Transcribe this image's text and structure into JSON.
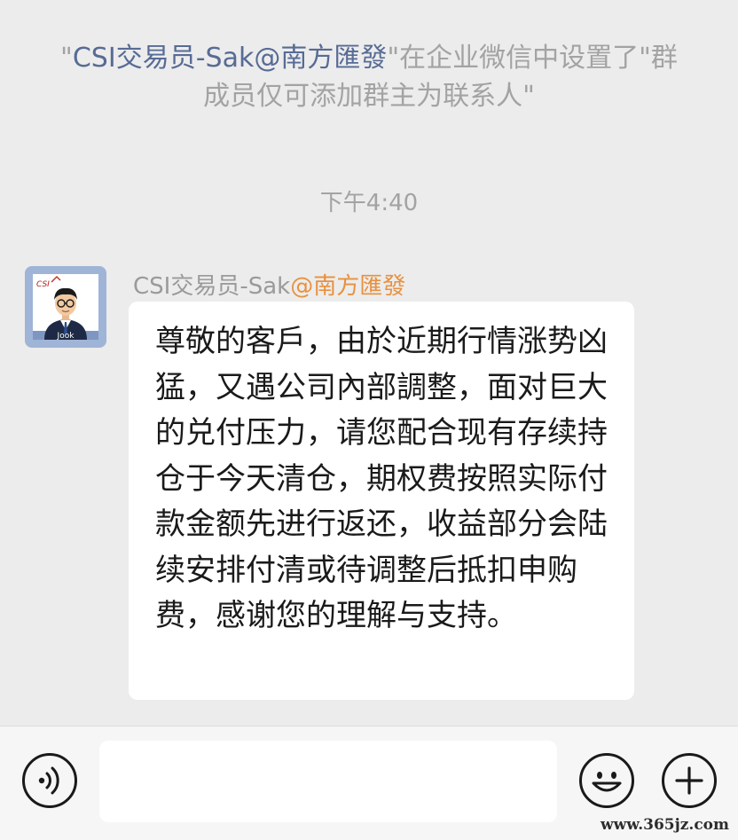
{
  "system_notice": {
    "quote_open": "\"",
    "member_name": "CSI交易员-Sak@南方匯發",
    "message": "\"在企业微信中设置了\"群成员仅可添加群主为联系人\""
  },
  "timestamp": "下午4:40",
  "message": {
    "sender_name": "CSI交易员-Sak",
    "sender_corp": "@南方匯發",
    "avatar_label": "Jook",
    "avatar_logo": "CSI",
    "text": "尊敬的客戶，由於近期行情涨势凶猛，又遇公司內部調整，面对巨大的兑付压力，请您配合现有存续持仓于今天清仓，期权费按照实际付款金额先进行返还，收益部分会陆续安排付清或待调整后抵扣申购费，感谢您的理解与支持。"
  },
  "input_bar": {
    "voice_icon": "voice-icon",
    "emoji_icon": "emoji-icon",
    "plus_icon": "plus-icon",
    "input_value": ""
  },
  "watermark": "www.365jz.com",
  "colors": {
    "background": "#ececec",
    "bubble": "#ffffff",
    "link_blue": "#576b95",
    "corp_orange": "#e8913f",
    "meta_gray": "#a3a3a3"
  }
}
